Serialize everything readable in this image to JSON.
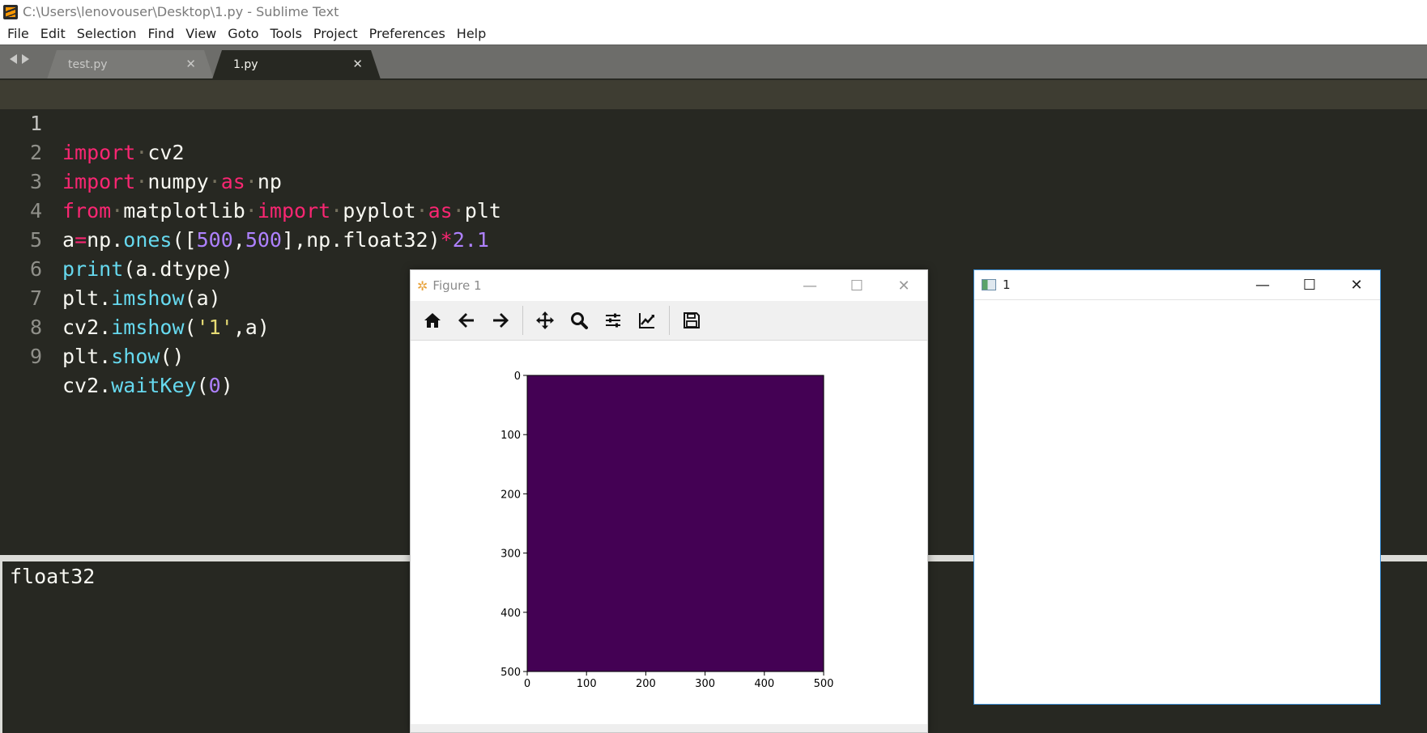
{
  "window": {
    "title": "C:\\Users\\lenovouser\\Desktop\\1.py - Sublime Text"
  },
  "menu": [
    "File",
    "Edit",
    "Selection",
    "Find",
    "View",
    "Goto",
    "Tools",
    "Project",
    "Preferences",
    "Help"
  ],
  "tabs": [
    {
      "label": "test.py",
      "active": false
    },
    {
      "label": "1.py",
      "active": true
    }
  ],
  "editor": {
    "current_line": 1,
    "line_numbers": [
      "1",
      "2",
      "3",
      "4",
      "5",
      "6",
      "7",
      "8",
      "9"
    ],
    "lines": [
      "import cv2",
      "import numpy as np",
      "from matplotlib import pyplot as plt",
      "a=np.ones([500,500],np.float32)*2.1",
      "print(a.dtype)",
      "plt.imshow(a)",
      "cv2.imshow('1',a)",
      "plt.show()",
      "cv2.waitKey(0)"
    ]
  },
  "console": {
    "output": "float32"
  },
  "figure_window": {
    "title": "Figure 1",
    "toolbar_icons": [
      "home-icon",
      "back-icon",
      "forward-icon",
      "pan-icon",
      "zoom-icon",
      "subplots-config-icon",
      "edit-axes-icon",
      "save-icon"
    ]
  },
  "cv_window": {
    "title": "1"
  },
  "chart_data": {
    "type": "heatmap",
    "title": "",
    "xlabel": "",
    "ylabel": "",
    "xlim": [
      0,
      500
    ],
    "ylim": [
      500,
      0
    ],
    "x_ticks": [
      "0",
      "100",
      "200",
      "300",
      "400",
      "500"
    ],
    "y_ticks": [
      "0",
      "100",
      "200",
      "300",
      "400",
      "500"
    ],
    "value": 2.1,
    "fill_color": "#440154"
  },
  "colors": {
    "editor_bg": "#272822",
    "keyword": "#f92672",
    "function": "#66d9ef",
    "number": "#ae81ff",
    "string": "#e6db74",
    "viridis_low": "#440154"
  }
}
